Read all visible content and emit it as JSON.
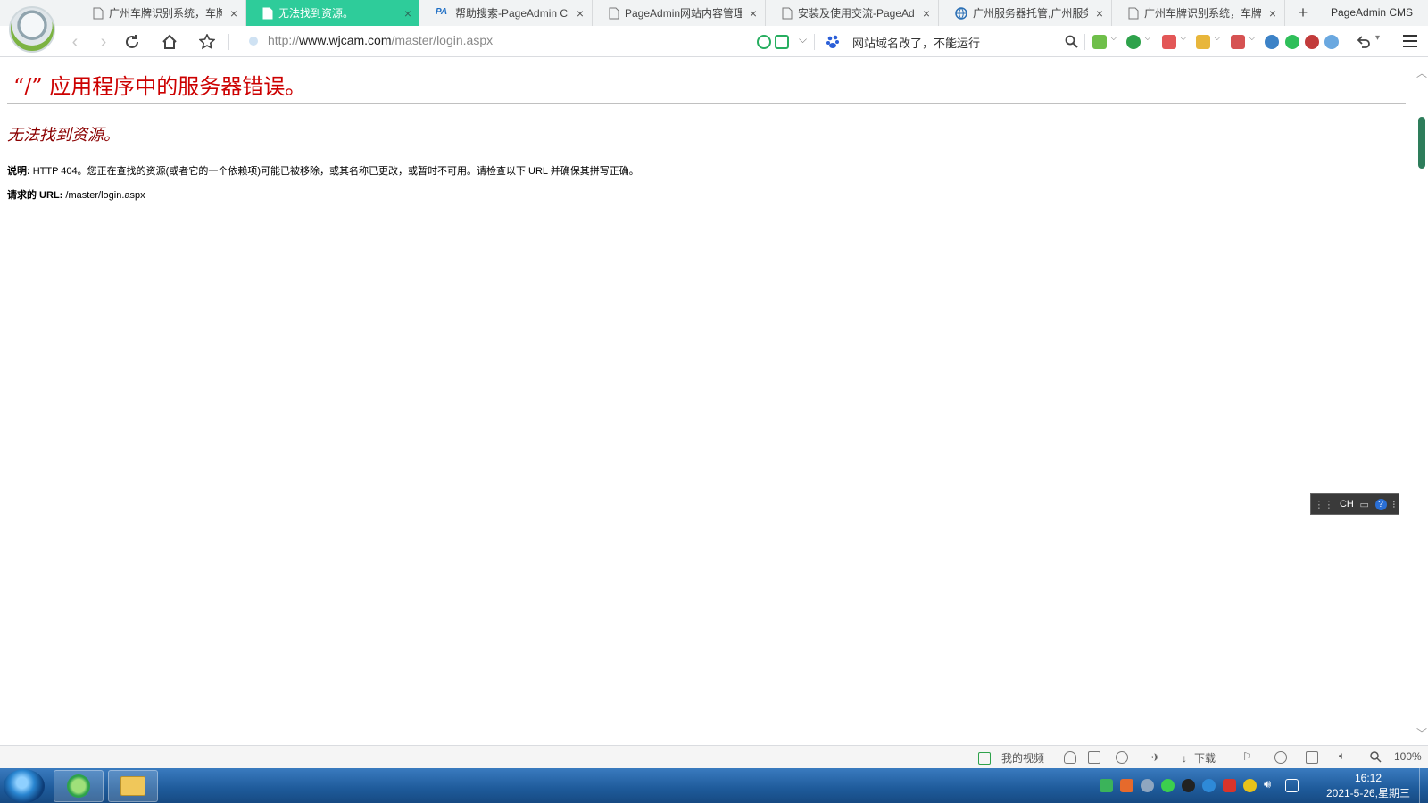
{
  "window": {
    "title": "PageAdmin CMS"
  },
  "tabs": [
    {
      "title": "广州车牌识别系统，车牌…",
      "active": false,
      "icon": "page-icon"
    },
    {
      "title": "无法找到资源。",
      "active": true,
      "icon": "page-icon"
    },
    {
      "title": "帮助搜索-PageAdmin CM…",
      "active": false,
      "icon": "pageadmin-logo-icon"
    },
    {
      "title": "PageAdmin网站内容管理…",
      "active": false,
      "icon": "page-icon"
    },
    {
      "title": "安装及使用交流-PageAd…",
      "active": false,
      "icon": "page-icon"
    },
    {
      "title": "广州服务器托管,广州服务…",
      "active": false,
      "icon": "globe-icon"
    },
    {
      "title": "广州车牌识别系统，车牌…",
      "active": false,
      "icon": "page-icon"
    }
  ],
  "toolbar": {
    "url_prefix": "http://",
    "url_domain": "www.wjcam.com",
    "url_path": "/master/login.aspx",
    "search_text": "网站域名改了，不能运行"
  },
  "page": {
    "error_title": "“/” 应用程序中的服务器错误。",
    "error_subtitle": "无法找到资源。",
    "desc_label": "说明:",
    "desc_text": " HTTP 404。您正在查找的资源(或者它的一个依赖项)可能已被移除，或其名称已更改，或暂时不可用。请检查以下 URL 并确保其拼写正确。",
    "url_label": "请求的 URL:",
    "url_value": " /master/login.aspx"
  },
  "ime": {
    "label": "CH"
  },
  "statusbar": {
    "my_video": "我的视频",
    "download": "下载",
    "zoom": "100%"
  },
  "taskbar": {
    "time": "16:12",
    "date": "2021-5-26,星期三"
  },
  "colors": {
    "active_tab": "#2ecc9a",
    "error_title": "#cc0000",
    "error_subtitle": "#8b0000",
    "taskbar": "#1e5a9a"
  }
}
